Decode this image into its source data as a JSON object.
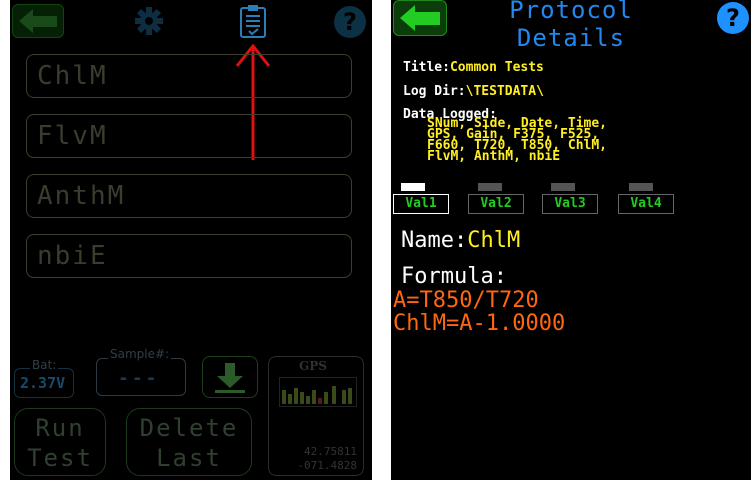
{
  "left_screen": {
    "fields": [
      "ChlM",
      "FlvM",
      "AnthM",
      "nbiE"
    ],
    "bat_label": "Bat:",
    "bat_value": "2.37V",
    "sample_label": "Sample#:",
    "sample_value": "---",
    "gps_label": "GPS",
    "gps_lat": "42.75811",
    "gps_lon": "-071.4828",
    "run_button": [
      "Run",
      "Test"
    ],
    "delete_button": [
      "Delete",
      "Last"
    ]
  },
  "right_screen": {
    "title": [
      "Protocol",
      "Details"
    ],
    "title_label": "Title:",
    "title_value": "Common Tests",
    "logdir_label": "Log Dir:",
    "logdir_value": "\\TESTDATA\\",
    "data_logged_label": "Data Logged:",
    "data_logged_lines": [
      "SNum, Side, Date, Time,",
      "GPS, Gain, F375, F525,",
      "F660, T720, T850, ChlM,",
      "FlvM, AnthM, nbiE"
    ],
    "tabs": [
      "Val1",
      "Val2",
      "Val3",
      "Val4"
    ],
    "active_tab": "Val1",
    "name_label": "Name:",
    "name_value": "ChlM",
    "formula_label": "Formula:",
    "formula_lines": [
      "A=T850/T720",
      "ChlM=A-1.0000"
    ]
  },
  "colors": {
    "accent_blue": "#2288ee",
    "value_yellow": "#ffee22",
    "formula_orange": "#ff6611",
    "tab_green": "#22cc22",
    "annotation_red": "#dd1111"
  },
  "icons": [
    "back-arrow-icon",
    "gear-icon",
    "clipboard-icon",
    "help-icon",
    "download-icon",
    "up-arrow-annotation"
  ]
}
